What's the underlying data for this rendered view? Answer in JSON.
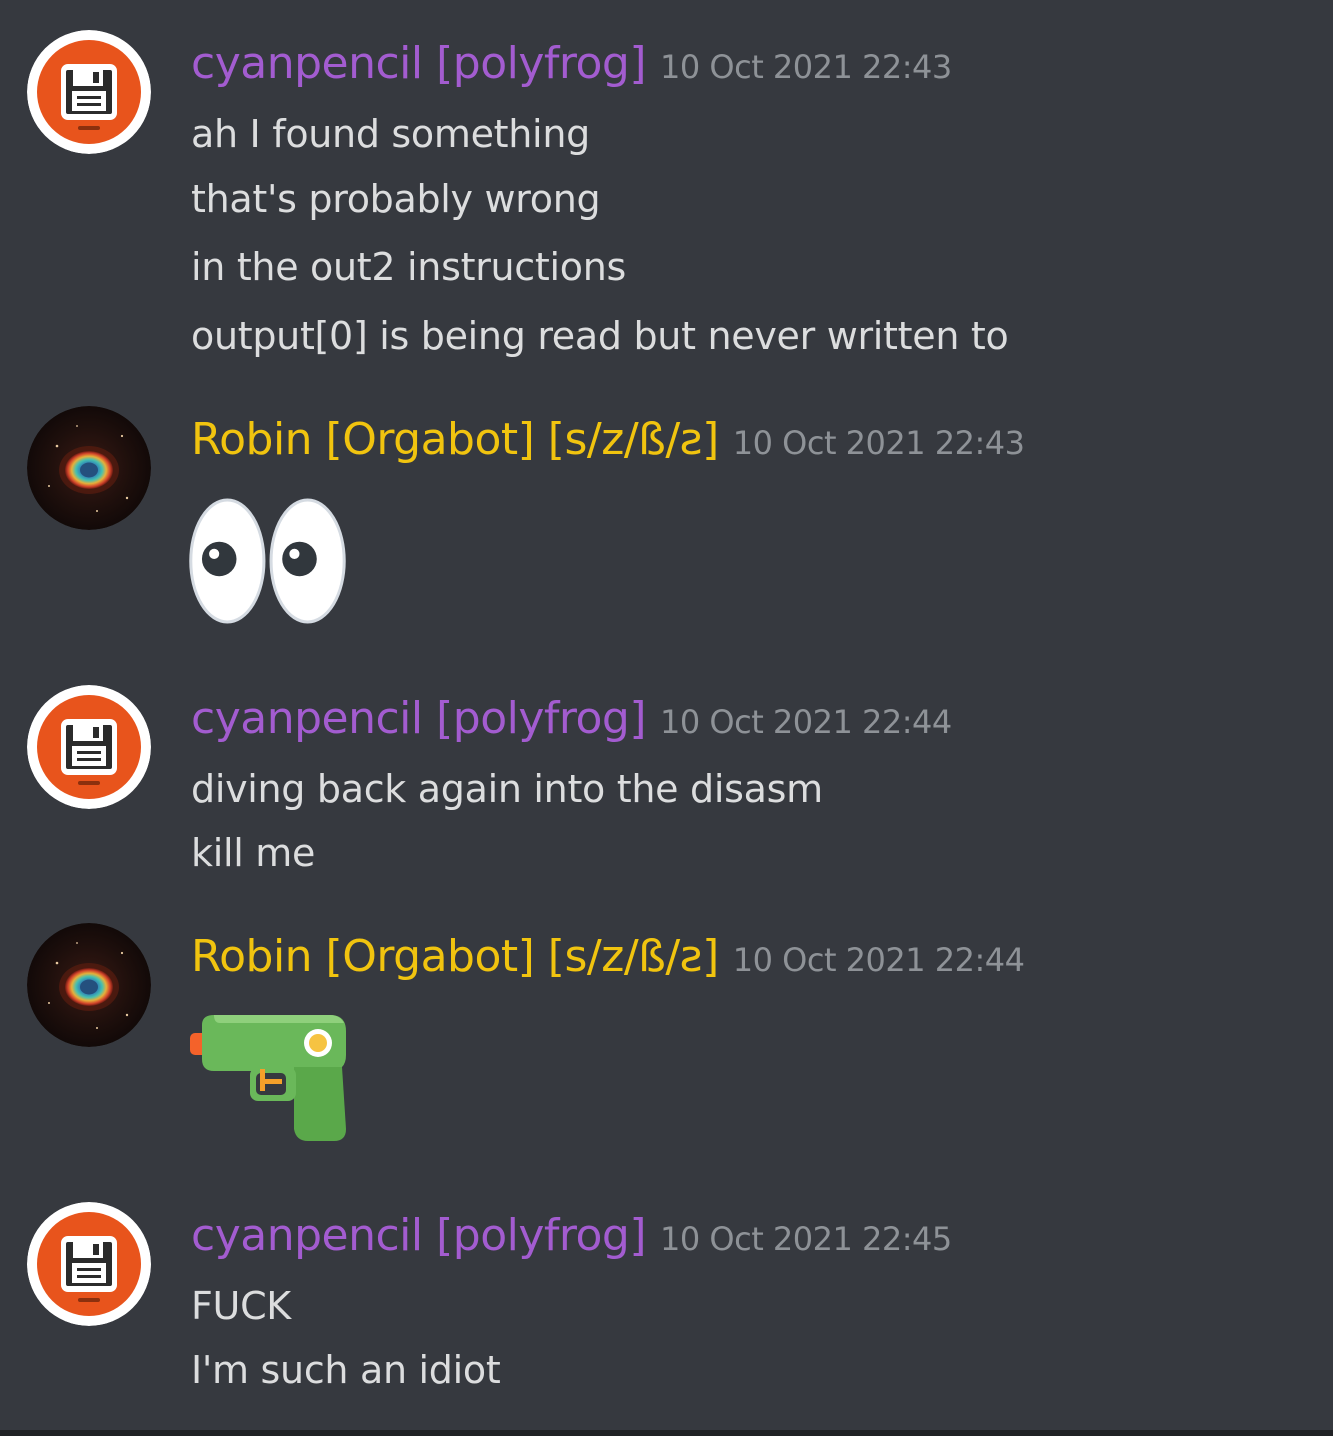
{
  "messages": [
    {
      "author": "cyanpencil [polyfrog]",
      "timestamp": "10 Oct 2021 22:43",
      "avatar": "floppy-disk-icon",
      "lines": [
        "ah I found something",
        "that's probably wrong",
        "in the out2 instructions",
        "output[0] is being read but never written to"
      ]
    },
    {
      "author": "Robin [Orgabot] [s/z/ß/ƨ]",
      "timestamp": "10 Oct 2021 22:43",
      "avatar": "nebula-eye-icon",
      "emoji": "eyes-emoji"
    },
    {
      "author": "cyanpencil [polyfrog]",
      "timestamp": "10 Oct 2021 22:44",
      "avatar": "floppy-disk-icon",
      "lines": [
        "diving back again into the disasm",
        "kill me"
      ]
    },
    {
      "author": "Robin [Orgabot] [s/z/ß/ƨ]",
      "timestamp": "10 Oct 2021 22:44",
      "avatar": "nebula-eye-icon",
      "emoji": "water-pistol-emoji"
    },
    {
      "author": "cyanpencil [polyfrog]",
      "timestamp": "10 Oct 2021 22:45",
      "avatar": "floppy-disk-icon",
      "lines": [
        "FUCK",
        "I'm such an idiot"
      ]
    }
  ],
  "colors": {
    "background": "#36393f",
    "cyanpencil_name": "#a35cd0",
    "robin_name": "#f1c40f",
    "timestamp": "#8e9297",
    "message_text": "#dcddde",
    "floppy_avatar_bg": "#e8541c"
  }
}
